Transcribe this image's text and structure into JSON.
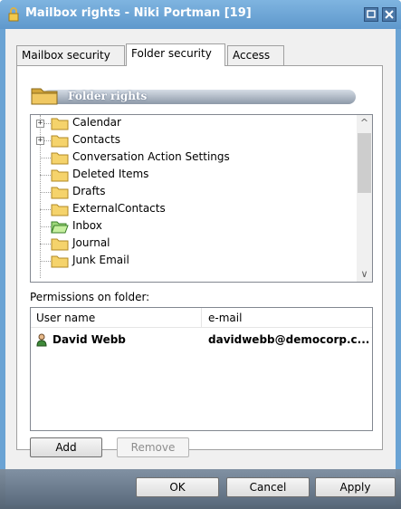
{
  "window": {
    "title": "Mailbox rights - Niki Portman [19]",
    "accent_color": "#6aa3d4"
  },
  "tabs": [
    {
      "label": "Mailbox security",
      "active": false
    },
    {
      "label": "Folder security",
      "active": true
    },
    {
      "label": "Access",
      "active": false
    }
  ],
  "folder_rights": {
    "header": "Folder rights"
  },
  "tree": {
    "items": [
      {
        "label": "Calendar",
        "expandable": true,
        "icon": "folder-icon"
      },
      {
        "label": "Contacts",
        "expandable": true,
        "icon": "folder-icon"
      },
      {
        "label": "Conversation Action Settings",
        "expandable": false,
        "icon": "folder-icon"
      },
      {
        "label": "Deleted Items",
        "expandable": false,
        "icon": "folder-icon"
      },
      {
        "label": "Drafts",
        "expandable": false,
        "icon": "folder-icon"
      },
      {
        "label": "ExternalContacts",
        "expandable": false,
        "icon": "folder-icon"
      },
      {
        "label": "Inbox",
        "expandable": false,
        "icon": "open-folder-icon"
      },
      {
        "label": "Journal",
        "expandable": false,
        "icon": "folder-icon"
      },
      {
        "label": "Junk Email",
        "expandable": false,
        "icon": "folder-icon"
      }
    ]
  },
  "permissions": {
    "label": "Permissions on folder:",
    "columns": [
      "User name",
      "e-mail"
    ],
    "rows": [
      {
        "user": "David Webb",
        "email": "davidwebb@democorp.c...",
        "icon": "user-icon"
      }
    ]
  },
  "buttons": {
    "add": "Add",
    "remove": "Remove",
    "ok": "OK",
    "cancel": "Cancel",
    "apply": "Apply"
  }
}
